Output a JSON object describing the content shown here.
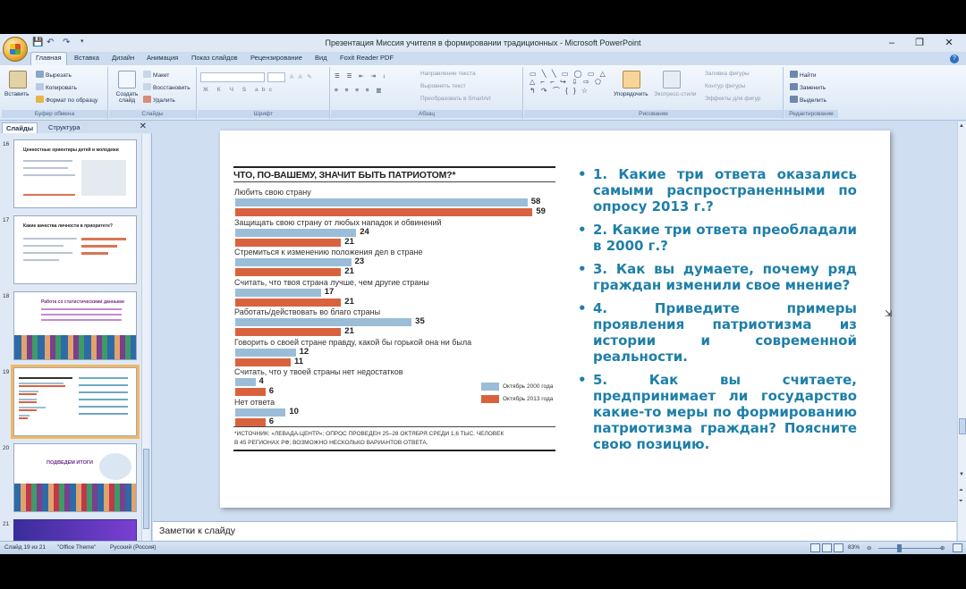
{
  "window": {
    "title": "Презентация Миссия учителя в формировании традиционных - Microsoft PowerPoint",
    "minimize": "–",
    "maximize": "❐",
    "close": "✕",
    "quick_access": [
      "💾",
      "↶",
      "↷",
      "▾"
    ]
  },
  "ribbon_tabs": [
    "Главная",
    "Вставка",
    "Дизайн",
    "Анимация",
    "Показ слайдов",
    "Рецензирование",
    "Вид",
    "Foxit Reader PDF"
  ],
  "ribbon": {
    "clipboard": {
      "paste": "Вставить",
      "cut": "Вырезать",
      "copy": "Копировать",
      "format_painter": "Формат по образцу",
      "label": "Буфер обмена"
    },
    "slides": {
      "new_slide": "Создать слайд",
      "layout": "Макет",
      "reset": "Восстановить",
      "delete": "Удалить",
      "label": "Слайды"
    },
    "font": {
      "label": "Шрифт"
    },
    "paragraph": {
      "text_direction": "Направление текста",
      "align_text": "Выровнять текст",
      "smartart": "Преобразовать в SmartArt",
      "label": "Абзац"
    },
    "drawing": {
      "arrange": "Упорядочить",
      "quick_styles": "Экспресс-стили",
      "fill": "Заливка фигуры",
      "outline": "Контур фигуры",
      "effects": "Эффекты для фигур",
      "label": "Рисование"
    },
    "editing": {
      "find": "Найти",
      "replace": "Заменить",
      "select": "Выделить",
      "label": "Редактирование"
    }
  },
  "left_pane": {
    "tabs": [
      "Слайды",
      "Структура"
    ],
    "close": "✕",
    "thumbnails": [
      {
        "number": "16",
        "title": "Ценностные ориентиры детей и молодежи"
      },
      {
        "number": "17",
        "title": "Какие качества личности в приоритете?"
      },
      {
        "number": "18",
        "title": "Работа со статистическими данными"
      },
      {
        "number": "19",
        "title": ""
      },
      {
        "number": "20",
        "title": "ПОДВЕДЕМ ИТОГИ"
      },
      {
        "number": "21",
        "title": ""
      }
    ]
  },
  "chart_data": {
    "type": "bar",
    "title": "ЧТО, ПО-ВАШЕМУ, ЗНАЧИТ БЫТЬ ПАТРИОТОМ?*",
    "categories": [
      "Любить свою страну",
      "Защищать свою страну от любых нападок и обвинений",
      "Стремиться к изменению положения дел в стране",
      "Считать, что твоя страна лучше, чем другие страны",
      "Работать/действовать во благо страны",
      "Говорить о своей стране правду, какой бы горькой она ни была",
      "Считать, что у твоей страны нет недостатков",
      "Нет ответа"
    ],
    "series": [
      {
        "name": "Октябрь 2000 года",
        "color": "#9bbdd7",
        "values": [
          58,
          24,
          23,
          17,
          35,
          12,
          4,
          10
        ]
      },
      {
        "name": "Октябрь 2013 года",
        "color": "#d9623e",
        "values": [
          59,
          21,
          21,
          21,
          21,
          11,
          6,
          6
        ]
      }
    ],
    "notes": [
      "*ИСТОЧНИК: «ЛЕВАДА-ЦЕНТР»; ОПРОС ПРОВЕДЕН 25–28 ОКТЯБРЯ СРЕДИ 1,6 ТЫС. ЧЕЛОВЕК",
      "В 45 РЕГИОНАХ РФ; ВОЗМОЖНО НЕСКОЛЬКО ВАРИАНТОВ ОТВЕТА."
    ],
    "xlim": [
      0,
      60
    ]
  },
  "questions": [
    "1. Какие три ответа оказались самыми распространенными по опросу 2013 г.?",
    "2. Какие три ответа преобладали в 2000 г.?",
    "3. Как вы думаете, почему ряд граждан изменили свое мнение?",
    "4. Приведите примеры проявления патриотизма из истории и современной реальности.",
    "5. Как вы считаете, предпринимает ли государство какие-то меры по формированию патриотизма граждан? Поясните свою позицию."
  ],
  "notes_placeholder": "Заметки к слайду",
  "status": {
    "slide": "Слайд 19 из 21",
    "theme": "\"Office Theme\"",
    "language": "Русский (Россия)",
    "zoom": "83%"
  }
}
